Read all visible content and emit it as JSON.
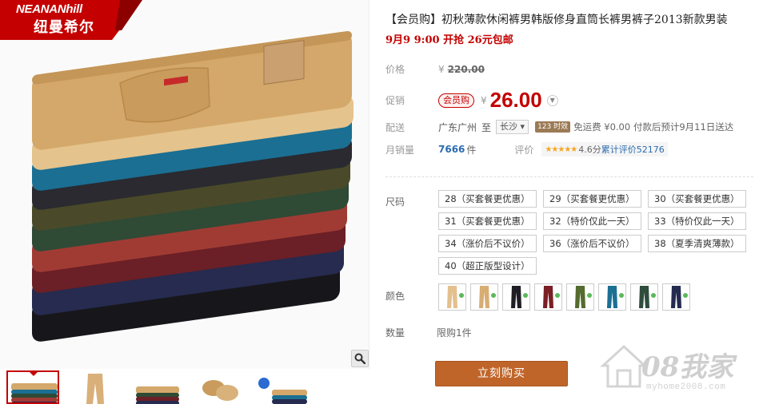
{
  "brand": {
    "logo_text": "NEANANhill",
    "logo_text_cn": "纽曼希尔"
  },
  "gallery": {
    "zoom_icon": "magnifier-icon",
    "thumbnails": [
      {
        "name": "thumb-stack-front",
        "active": true
      },
      {
        "name": "thumb-single-pants",
        "active": false
      },
      {
        "name": "thumb-stack-side",
        "active": false
      },
      {
        "name": "thumb-rolled",
        "active": false
      },
      {
        "name": "thumb-combo",
        "active": false
      }
    ]
  },
  "product": {
    "title": "【会员购】初秋薄款休闲裤男韩版修身直筒长裤男裤子2013新款男装",
    "promo": "9月9 9:00 开抢 26元包邮"
  },
  "pricing": {
    "price_label": "价格",
    "currency": "¥",
    "original_price": "220.00",
    "promo_label": "促销",
    "member_badge": "会员购",
    "sale_price": "26.00"
  },
  "delivery": {
    "label": "配送",
    "origin": "广东广州",
    "to": "至",
    "destination": "长沙",
    "express_badge": "123 时效",
    "shipping": "免运费 ¥0.00 付款后预计9月11日送达"
  },
  "sales": {
    "label": "月销量",
    "count": "7666",
    "unit": "件",
    "review_label": "评价",
    "stars": "★★★★★",
    "rating": "4.6分",
    "review_text": "累计评价52176"
  },
  "sizes": {
    "label": "尺码",
    "options": [
      "28（买套餐更优惠）",
      "29（买套餐更优惠）",
      "30（买套餐更优惠）",
      "31（买套餐更优惠）",
      "32（特价仅此一天）",
      "33（特价仅此一天）",
      "34（涨价后不议价）",
      "36（涨价后不议价）",
      "38（夏季清爽薄款）",
      "40（超正版型设计）"
    ]
  },
  "colors": {
    "label": "颜色",
    "swatches": [
      {
        "name": "khaki-light",
        "hex": "#e3c08e"
      },
      {
        "name": "khaki",
        "hex": "#d7ad74"
      },
      {
        "name": "black",
        "hex": "#1e1e24"
      },
      {
        "name": "wine-red",
        "hex": "#7a1f25"
      },
      {
        "name": "army-green",
        "hex": "#556b2f"
      },
      {
        "name": "teal-blue",
        "hex": "#1b6f93"
      },
      {
        "name": "dark-green",
        "hex": "#2f4d3d"
      },
      {
        "name": "navy",
        "hex": "#252a4f"
      }
    ]
  },
  "quantity": {
    "label": "数量",
    "limit": "限购1件"
  },
  "actions": {
    "buy_now": "立刻购买"
  },
  "watermark": {
    "logo": "08我家",
    "url": "myhome2008.com"
  },
  "theme": {
    "brand_red": "#c40000",
    "buy_button": "#c0652a"
  }
}
